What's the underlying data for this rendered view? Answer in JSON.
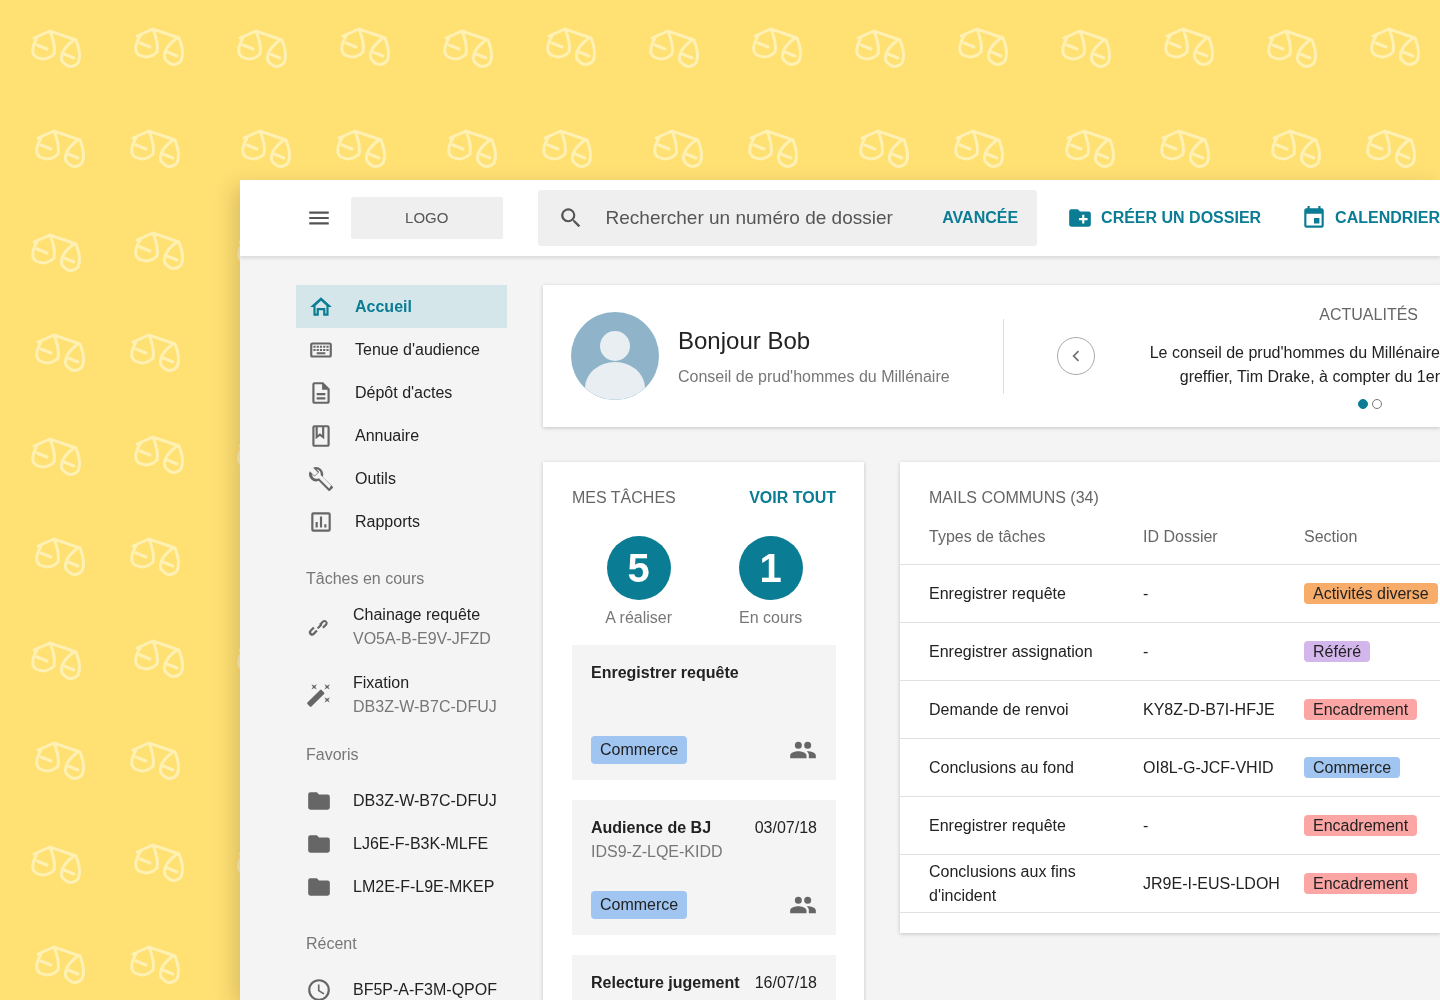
{
  "header": {
    "logo": "LOGO",
    "search": {
      "placeholder": "Rechercher un numéro de dossier",
      "advanced": "AVANCÉE"
    },
    "actions": [
      {
        "label": "CRÉER UN DOSSIER"
      },
      {
        "label": "CALENDRIER"
      }
    ]
  },
  "sidebar": {
    "nav": [
      {
        "label": "Accueil",
        "selected": true
      },
      {
        "label": "Tenue d'audience",
        "selected": false
      },
      {
        "label": "Dépôt d'actes",
        "selected": false
      },
      {
        "label": "Annuaire",
        "selected": false
      },
      {
        "label": "Outils",
        "selected": false
      },
      {
        "label": "Rapports",
        "selected": false
      }
    ],
    "sections": [
      {
        "title": "Tâches en cours",
        "items": [
          {
            "label": "Chainage requête",
            "sub": "VO5A-B-E9V-JFZD"
          },
          {
            "label": "Fixation",
            "sub": "DB3Z-W-B7C-DFUJ"
          }
        ]
      },
      {
        "title": "Favoris",
        "items": [
          {
            "label": "DB3Z-W-B7C-DFUJ"
          },
          {
            "label": "LJ6E-F-B3K-MLFE"
          },
          {
            "label": "LM2E-F-L9E-MKEP"
          }
        ]
      },
      {
        "title": "Récent",
        "items": [
          {
            "label": "BF5P-A-F3M-QPOF"
          }
        ]
      }
    ]
  },
  "welcome": {
    "greeting": "Bonjour Bob",
    "court": "Conseil de prud'hommes du Millénaire",
    "news": {
      "title": "ACTUALITÉS",
      "lines": [
        "Le conseil de prud'hommes du Millénaire",
        "greffier, Tim Drake, à compter du 1er"
      ],
      "dots": [
        {
          "selected": true
        },
        {
          "selected": false
        }
      ]
    }
  },
  "tasks": {
    "title": "MES TÂCHES",
    "link": "VOIR TOUT",
    "counters": [
      {
        "value": "5",
        "label": "A réaliser"
      },
      {
        "value": "1",
        "label": "En cours"
      }
    ],
    "items": [
      {
        "title": "Enregistrer requête",
        "tag": {
          "label": "Commerce",
          "color": "#9fc5f0"
        }
      },
      {
        "title": "Audience de BJ",
        "date": "03/07/18",
        "id": "IDS9-Z-LQE-KIDD",
        "tag": {
          "label": "Commerce",
          "color": "#9fc5f0"
        }
      },
      {
        "title": "Relecture jugement",
        "date": "16/07/18"
      }
    ]
  },
  "mails": {
    "title": "MAILS COMMUNS (34)",
    "columns": [
      "Types de tâches",
      "ID Dossier",
      "Section"
    ],
    "rows": [
      {
        "type": "Enregistrer requête",
        "id": "-",
        "section": {
          "label": "Activités diverse",
          "color": "#f7ac69"
        }
      },
      {
        "type": "Enregistrer assignation",
        "id": "-",
        "section": {
          "label": "Référé",
          "color": "#d3b6ec"
        }
      },
      {
        "type": "Demande de renvoi",
        "id": "KY8Z-D-B7I-HFJE",
        "section": {
          "label": "Encadrement",
          "color": "#fca5a5"
        }
      },
      {
        "type": "Conclusions au fond",
        "id": "OI8L-G-JCF-VHID",
        "section": {
          "label": "Commerce",
          "color": "#9fc5f0"
        }
      },
      {
        "type": "Enregistrer requête",
        "id": "-",
        "section": {
          "label": "Encadrement",
          "color": "#fca5a5"
        }
      },
      {
        "type": "Conclusions aux fins d'incident",
        "id": "JR9E-I-EUS-LDOH",
        "section": {
          "label": "Encadrement",
          "color": "#fca5a5"
        }
      }
    ]
  }
}
